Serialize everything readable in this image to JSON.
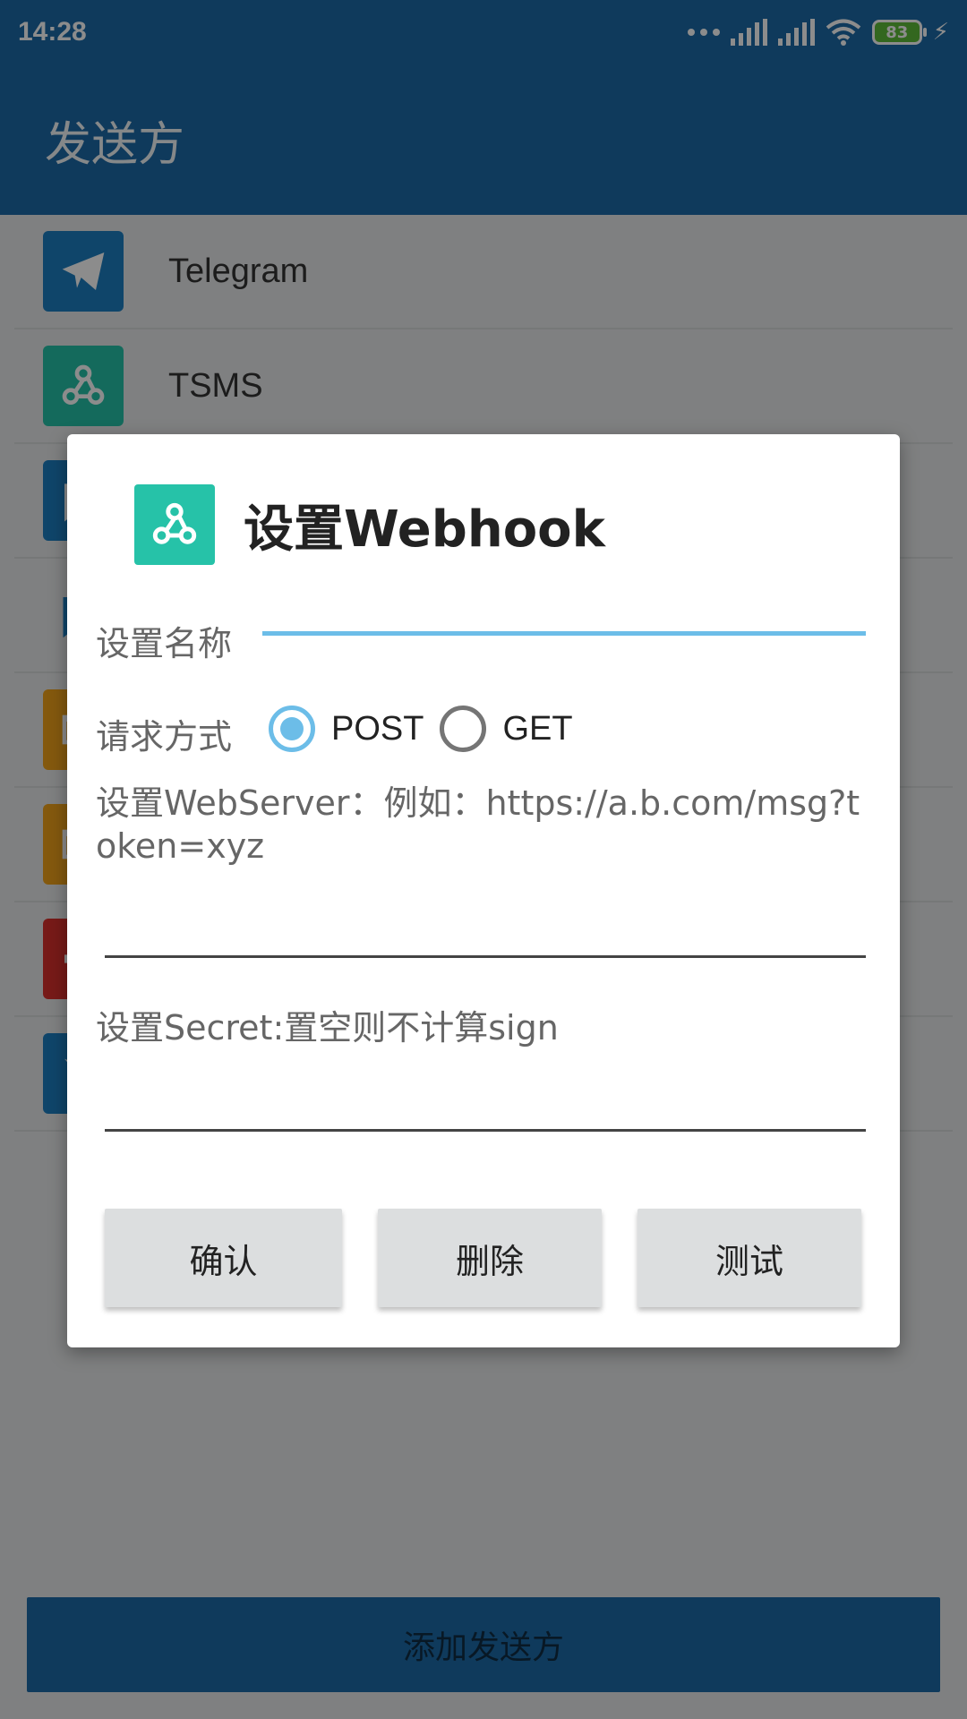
{
  "status_bar": {
    "time": "14:28",
    "battery": "83"
  },
  "app_bar": {
    "title": "发送方"
  },
  "list": {
    "items": [
      {
        "label": "Telegram",
        "icon": "telegram-icon",
        "color": "#1d7fc2"
      },
      {
        "label": "TSMS",
        "icon": "webhook-icon",
        "color": "#26c2a8"
      },
      {
        "label": "",
        "icon": "chat-bubble-icon",
        "color": "#1d7fc2"
      },
      {
        "label": "",
        "icon": "chat-outline-icon",
        "color": "#e8eaeb"
      },
      {
        "label": "",
        "icon": "mail-icon",
        "color": "#f0a21a"
      },
      {
        "label": "",
        "icon": "mail-icon",
        "color": "#f0a21a"
      },
      {
        "label": "",
        "icon": "megaphone-icon",
        "color": "#d9302c"
      },
      {
        "label": "",
        "icon": "feishu-icon",
        "color": "#1d7fc2"
      }
    ]
  },
  "bottom_button": {
    "label": "添加发送方"
  },
  "dialog": {
    "title": "设置Webhook",
    "name_label": "设置名称",
    "name_value": "",
    "method_label": "请求方式",
    "methods": [
      {
        "label": "POST",
        "checked": true
      },
      {
        "label": "GET",
        "checked": false
      }
    ],
    "server_hint": "设置WebServer：例如：https://a.b.com/msg?token=xyz",
    "server_value": "",
    "secret_hint": "设置Secret:置空则不计算sign",
    "secret_value": "",
    "buttons": {
      "confirm": "确认",
      "delete": "删除",
      "test": "测试"
    }
  },
  "colors": {
    "primary": "#1c6aa8",
    "accent": "#6cbde8",
    "webhook": "#26c2a8"
  }
}
